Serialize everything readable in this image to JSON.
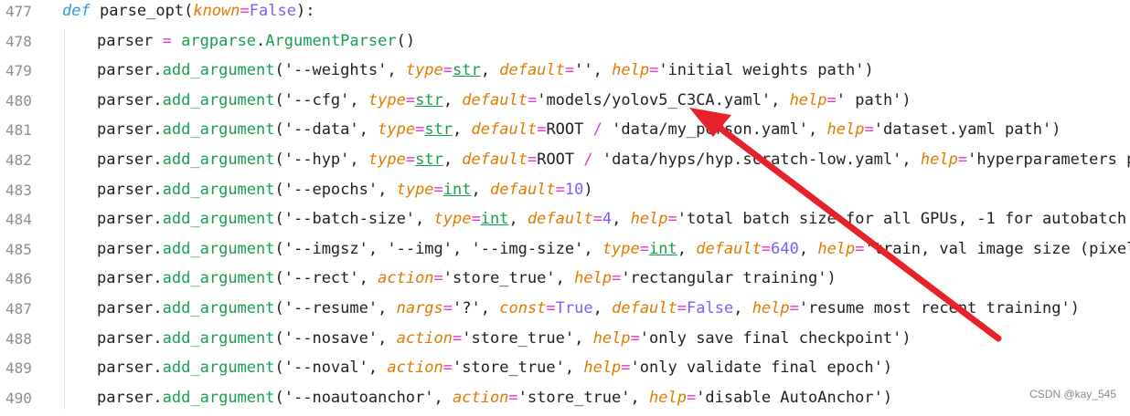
{
  "watermark": "CSDN @kay_545",
  "lines": [
    {
      "num": "477",
      "tokens": [
        [
          "kw",
          "def "
        ],
        [
          "fn",
          "parse_opt"
        ],
        [
          "punc",
          "("
        ],
        [
          "param",
          "known"
        ],
        [
          "op",
          "="
        ],
        [
          "const",
          "False"
        ],
        [
          "punc",
          "):"
        ]
      ]
    },
    {
      "num": "478",
      "tokens": [
        [
          "plain",
          "parser "
        ],
        [
          "op",
          "="
        ],
        [
          "plain",
          " "
        ],
        [
          "mod",
          "argparse"
        ],
        [
          "punc",
          "."
        ],
        [
          "call",
          "ArgumentParser"
        ],
        [
          "punc",
          "()"
        ]
      ]
    },
    {
      "num": "479",
      "tokens": [
        [
          "plain",
          "parser"
        ],
        [
          "punc",
          "."
        ],
        [
          "call",
          "add_argument"
        ],
        [
          "punc",
          "("
        ],
        [
          "str",
          "'--weights'"
        ],
        [
          "punc",
          ", "
        ],
        [
          "kwarg",
          "type"
        ],
        [
          "op",
          "="
        ],
        [
          "type",
          "str"
        ],
        [
          "punc",
          ", "
        ],
        [
          "kwarg",
          "default"
        ],
        [
          "op",
          "="
        ],
        [
          "str",
          "''"
        ],
        [
          "punc",
          ", "
        ],
        [
          "kwarg",
          "help"
        ],
        [
          "op",
          "="
        ],
        [
          "str",
          "'initial weights path'"
        ],
        [
          "punc",
          ")"
        ]
      ]
    },
    {
      "num": "480",
      "tokens": [
        [
          "plain",
          "parser"
        ],
        [
          "punc",
          "."
        ],
        [
          "call",
          "add_argument"
        ],
        [
          "punc",
          "("
        ],
        [
          "str",
          "'--cfg'"
        ],
        [
          "punc",
          ", "
        ],
        [
          "kwarg",
          "type"
        ],
        [
          "op",
          "="
        ],
        [
          "type",
          "str"
        ],
        [
          "punc",
          ", "
        ],
        [
          "kwarg",
          "default"
        ],
        [
          "op",
          "="
        ],
        [
          "str",
          "'models/yolov5_C3CA.yaml'"
        ],
        [
          "punc",
          ", "
        ],
        [
          "kwarg",
          "help"
        ],
        [
          "op",
          "="
        ],
        [
          "str",
          "' path'"
        ],
        [
          "punc",
          ")"
        ]
      ]
    },
    {
      "num": "481",
      "tokens": [
        [
          "plain",
          "parser"
        ],
        [
          "punc",
          "."
        ],
        [
          "call",
          "add_argument"
        ],
        [
          "punc",
          "("
        ],
        [
          "str",
          "'--data'"
        ],
        [
          "punc",
          ", "
        ],
        [
          "kwarg",
          "type"
        ],
        [
          "op",
          "="
        ],
        [
          "type",
          "str"
        ],
        [
          "punc",
          ", "
        ],
        [
          "kwarg",
          "default"
        ],
        [
          "op",
          "="
        ],
        [
          "plain",
          "ROOT "
        ],
        [
          "op",
          "/"
        ],
        [
          "str",
          " 'data/my_person.yaml'"
        ],
        [
          "punc",
          ", "
        ],
        [
          "kwarg",
          "help"
        ],
        [
          "op",
          "="
        ],
        [
          "str",
          "'dataset.yaml path'"
        ],
        [
          "punc",
          ")"
        ]
      ]
    },
    {
      "num": "482",
      "tokens": [
        [
          "plain",
          "parser"
        ],
        [
          "punc",
          "."
        ],
        [
          "call",
          "add_argument"
        ],
        [
          "punc",
          "("
        ],
        [
          "str",
          "'--hyp'"
        ],
        [
          "punc",
          ", "
        ],
        [
          "kwarg",
          "type"
        ],
        [
          "op",
          "="
        ],
        [
          "type",
          "str"
        ],
        [
          "punc",
          ", "
        ],
        [
          "kwarg",
          "default"
        ],
        [
          "op",
          "="
        ],
        [
          "plain",
          "ROOT "
        ],
        [
          "op",
          "/"
        ],
        [
          "str",
          " 'data/hyps/hyp.scratch-low.yaml'"
        ],
        [
          "punc",
          ", "
        ],
        [
          "kwarg",
          "help"
        ],
        [
          "op",
          "="
        ],
        [
          "str",
          "'hyperparameters path'"
        ],
        [
          "punc",
          ")"
        ]
      ]
    },
    {
      "num": "483",
      "tokens": [
        [
          "plain",
          "parser"
        ],
        [
          "punc",
          "."
        ],
        [
          "call",
          "add_argument"
        ],
        [
          "punc",
          "("
        ],
        [
          "str",
          "'--epochs'"
        ],
        [
          "punc",
          ", "
        ],
        [
          "kwarg",
          "type"
        ],
        [
          "op",
          "="
        ],
        [
          "type",
          "int"
        ],
        [
          "punc",
          ", "
        ],
        [
          "kwarg",
          "default"
        ],
        [
          "op",
          "="
        ],
        [
          "num",
          "10"
        ],
        [
          "punc",
          ")"
        ]
      ]
    },
    {
      "num": "484",
      "tokens": [
        [
          "plain",
          "parser"
        ],
        [
          "punc",
          "."
        ],
        [
          "call",
          "add_argument"
        ],
        [
          "punc",
          "("
        ],
        [
          "str",
          "'--batch-size'"
        ],
        [
          "punc",
          ", "
        ],
        [
          "kwarg",
          "type"
        ],
        [
          "op",
          "="
        ],
        [
          "type",
          "int"
        ],
        [
          "punc",
          ", "
        ],
        [
          "kwarg",
          "default"
        ],
        [
          "op",
          "="
        ],
        [
          "num",
          "4"
        ],
        [
          "punc",
          ", "
        ],
        [
          "kwarg",
          "help"
        ],
        [
          "op",
          "="
        ],
        [
          "str",
          "'total batch size for all GPUs, -1 for autobatch'"
        ],
        [
          "punc",
          ")"
        ]
      ]
    },
    {
      "num": "485",
      "tokens": [
        [
          "plain",
          "parser"
        ],
        [
          "punc",
          "."
        ],
        [
          "call",
          "add_argument"
        ],
        [
          "punc",
          "("
        ],
        [
          "str",
          "'--imgsz'"
        ],
        [
          "punc",
          ", "
        ],
        [
          "str",
          "'--img'"
        ],
        [
          "punc",
          ", "
        ],
        [
          "str",
          "'--img-size'"
        ],
        [
          "punc",
          ", "
        ],
        [
          "kwarg",
          "type"
        ],
        [
          "op",
          "="
        ],
        [
          "type",
          "int"
        ],
        [
          "punc",
          ", "
        ],
        [
          "kwarg",
          "default"
        ],
        [
          "op",
          "="
        ],
        [
          "num",
          "640"
        ],
        [
          "punc",
          ", "
        ],
        [
          "kwarg",
          "help"
        ],
        [
          "op",
          "="
        ],
        [
          "str",
          "'train, val image size (pixels)'"
        ],
        [
          "punc",
          ")"
        ]
      ]
    },
    {
      "num": "486",
      "tokens": [
        [
          "plain",
          "parser"
        ],
        [
          "punc",
          "."
        ],
        [
          "call",
          "add_argument"
        ],
        [
          "punc",
          "("
        ],
        [
          "str",
          "'--rect'"
        ],
        [
          "punc",
          ", "
        ],
        [
          "kwarg",
          "action"
        ],
        [
          "op",
          "="
        ],
        [
          "str",
          "'store_true'"
        ],
        [
          "punc",
          ", "
        ],
        [
          "kwarg",
          "help"
        ],
        [
          "op",
          "="
        ],
        [
          "str",
          "'rectangular training'"
        ],
        [
          "punc",
          ")"
        ]
      ]
    },
    {
      "num": "487",
      "tokens": [
        [
          "plain",
          "parser"
        ],
        [
          "punc",
          "."
        ],
        [
          "call",
          "add_argument"
        ],
        [
          "punc",
          "("
        ],
        [
          "str",
          "'--resume'"
        ],
        [
          "punc",
          ", "
        ],
        [
          "kwarg",
          "nargs"
        ],
        [
          "op",
          "="
        ],
        [
          "str",
          "'?'"
        ],
        [
          "punc",
          ", "
        ],
        [
          "kwarg",
          "const"
        ],
        [
          "op",
          "="
        ],
        [
          "const",
          "True"
        ],
        [
          "punc",
          ", "
        ],
        [
          "kwarg",
          "default"
        ],
        [
          "op",
          "="
        ],
        [
          "const",
          "False"
        ],
        [
          "punc",
          ", "
        ],
        [
          "kwarg",
          "help"
        ],
        [
          "op",
          "="
        ],
        [
          "str",
          "'resume most recent training'"
        ],
        [
          "punc",
          ")"
        ]
      ]
    },
    {
      "num": "488",
      "tokens": [
        [
          "plain",
          "parser"
        ],
        [
          "punc",
          "."
        ],
        [
          "call",
          "add_argument"
        ],
        [
          "punc",
          "("
        ],
        [
          "str",
          "'--nosave'"
        ],
        [
          "punc",
          ", "
        ],
        [
          "kwarg",
          "action"
        ],
        [
          "op",
          "="
        ],
        [
          "str",
          "'store_true'"
        ],
        [
          "punc",
          ", "
        ],
        [
          "kwarg",
          "help"
        ],
        [
          "op",
          "="
        ],
        [
          "str",
          "'only save final checkpoint'"
        ],
        [
          "punc",
          ")"
        ]
      ]
    },
    {
      "num": "489",
      "tokens": [
        [
          "plain",
          "parser"
        ],
        [
          "punc",
          "."
        ],
        [
          "call",
          "add_argument"
        ],
        [
          "punc",
          "("
        ],
        [
          "str",
          "'--noval'"
        ],
        [
          "punc",
          ", "
        ],
        [
          "kwarg",
          "action"
        ],
        [
          "op",
          "="
        ],
        [
          "str",
          "'store_true'"
        ],
        [
          "punc",
          ", "
        ],
        [
          "kwarg",
          "help"
        ],
        [
          "op",
          "="
        ],
        [
          "str",
          "'only validate final epoch'"
        ],
        [
          "punc",
          ")"
        ]
      ]
    },
    {
      "num": "490",
      "tokens": [
        [
          "plain",
          "parser"
        ],
        [
          "punc",
          "."
        ],
        [
          "call",
          "add_argument"
        ],
        [
          "punc",
          "("
        ],
        [
          "str",
          "'--noautoanchor'"
        ],
        [
          "punc",
          ", "
        ],
        [
          "kwarg",
          "action"
        ],
        [
          "op",
          "="
        ],
        [
          "str",
          "'store_true'"
        ],
        [
          "punc",
          ", "
        ],
        [
          "kwarg",
          "help"
        ],
        [
          "op",
          "="
        ],
        [
          "str",
          "'disable AutoAnchor'"
        ],
        [
          "punc",
          ")"
        ]
      ]
    }
  ],
  "annotation": {
    "type": "arrow",
    "color": "#e8222a"
  }
}
